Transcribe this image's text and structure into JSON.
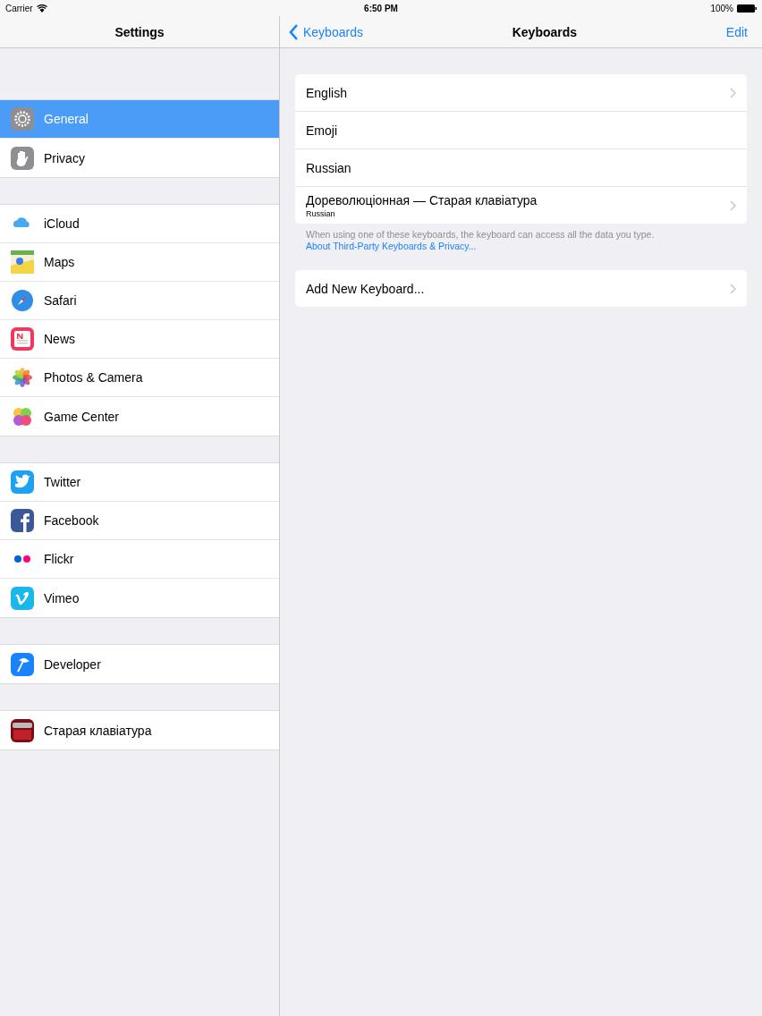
{
  "status_bar": {
    "carrier": "Carrier",
    "time": "6:50 PM",
    "battery": "100%"
  },
  "sidebar": {
    "title": "Settings",
    "groups": [
      [
        {
          "label": "General",
          "selected": true
        },
        {
          "label": "Privacy",
          "selected": false
        }
      ],
      [
        {
          "label": "iCloud",
          "selected": false
        },
        {
          "label": "Maps",
          "selected": false
        },
        {
          "label": "Safari",
          "selected": false
        },
        {
          "label": "News",
          "selected": false
        },
        {
          "label": "Photos & Camera",
          "selected": false
        },
        {
          "label": "Game Center",
          "selected": false
        }
      ],
      [
        {
          "label": "Twitter",
          "selected": false
        },
        {
          "label": "Facebook",
          "selected": false
        },
        {
          "label": "Flickr",
          "selected": false
        },
        {
          "label": "Vimeo",
          "selected": false
        }
      ],
      [
        {
          "label": "Developer",
          "selected": false
        }
      ],
      [
        {
          "label": "Старая клавіатура",
          "selected": false
        }
      ]
    ]
  },
  "detail": {
    "back": "Keyboards",
    "title": "Keyboards",
    "action": "Edit",
    "keyboards": [
      {
        "label": "English",
        "chevron": true
      },
      {
        "label": "Emoji",
        "chevron": false
      },
      {
        "label": "Russian",
        "chevron": false
      },
      {
        "label": "Дореволюцiонная  — Старая клавiатура",
        "subtitle": "Russian",
        "chevron": true
      }
    ],
    "footer": {
      "text": "When using one of these keyboards, the keyboard can access all the data you type.",
      "link": "About Third-Party Keyboards & Privacy..."
    },
    "add": {
      "label": "Add New Keyboard...",
      "chevron": true
    }
  }
}
